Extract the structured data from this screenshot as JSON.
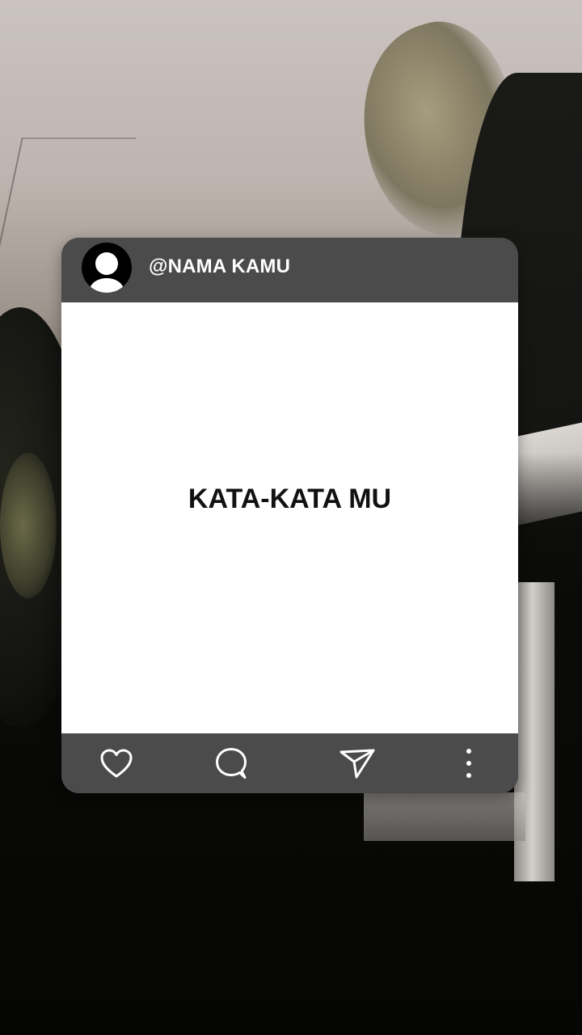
{
  "post": {
    "username": "@NAMA KAMU",
    "caption": "KATA-KATA MU"
  },
  "actions": [
    {
      "name": "like",
      "icon": "heart-icon"
    },
    {
      "name": "comment",
      "icon": "comment-icon"
    },
    {
      "name": "share",
      "icon": "send-icon"
    },
    {
      "name": "more",
      "icon": "more-vertical-icon"
    }
  ],
  "colors": {
    "card_bar": "#4b4b4b",
    "card_body": "#ffffff",
    "text_light": "#ffffff",
    "text_dark": "#111111"
  }
}
